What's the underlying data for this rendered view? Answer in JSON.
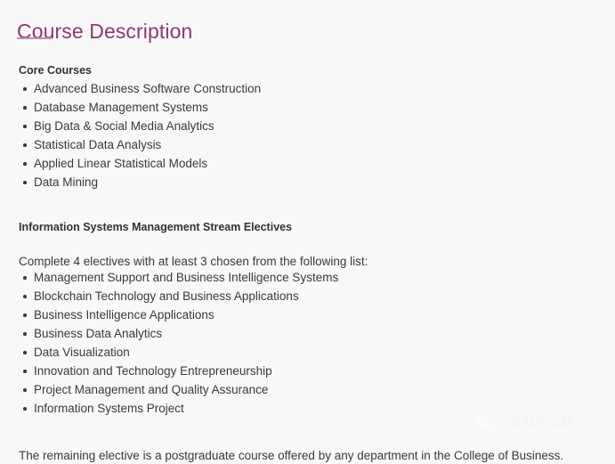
{
  "page": {
    "title": "Course Description",
    "background_color": "#f8f8f8",
    "title_color": "#8c3a6d",
    "rule_color": "#bb93b4",
    "text_color": "#3a3a3a"
  },
  "sections": {
    "core": {
      "heading": "Core Courses",
      "items": [
        "Advanced Business Software Construction",
        "Database Management Systems",
        "Big Data & Social Media Analytics",
        "Statistical Data Analysis",
        "Applied Linear Statistical Models",
        "Data Mining"
      ]
    },
    "electives": {
      "heading": "Information Systems Management Stream Electives",
      "intro": "Complete 4 electives with at least 3 chosen from the following list:",
      "items": [
        "Management Support and Business Intelligence Systems",
        "Blockchain Technology and Business Applications",
        "Business Intelligence Applications",
        "Business Data Analytics",
        "Data Visualization",
        "Innovation and Technology Entrepreneurship",
        "Project Management and Quality Assurance",
        "Information Systems Project"
      ],
      "closing": "The remaining elective is a postgraduate course offered by any department in the College of Business."
    }
  },
  "watermark": {
    "icon": "wechat-icon",
    "text": "宁波风华出国"
  }
}
